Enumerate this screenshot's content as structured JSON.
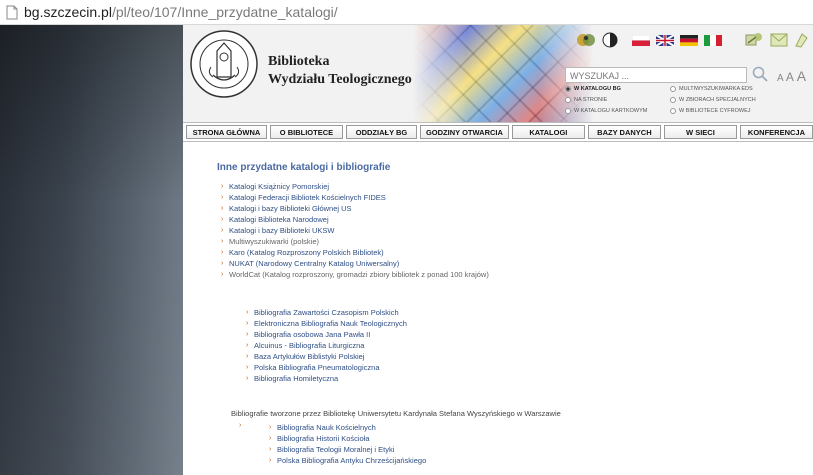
{
  "browser": {
    "url_host": "bg.szczecin.pl",
    "url_path": "/pl/teo/107/Inne_przydatne_katalogi/"
  },
  "header": {
    "title_line1": "Biblioteka",
    "title_line2": "Wydziału Teologicznego",
    "search_placeholder": "WYSZUKAJ ...",
    "font_size_labels": [
      "A",
      "A",
      "A"
    ],
    "radio_options": [
      {
        "label": "W KATALOGU BG",
        "selected": true
      },
      {
        "label": "MULTIWYSZUKIWARKA EDS",
        "selected": false
      },
      {
        "label": "NA STRONIE",
        "selected": false
      },
      {
        "label": "W ZBIORACH SPECJALNYCH",
        "selected": false
      },
      {
        "label": "W KATALOGU KARTKOWYM",
        "selected": false
      },
      {
        "label": "W BIBLIOTECE CYFROWEJ",
        "selected": false
      }
    ]
  },
  "nav": {
    "items": [
      "STRONA GŁÓWNA",
      "O BIBLIOTECE",
      "ODDZIAŁY BG",
      "GODZINY OTWARCIA",
      "KATALOGI",
      "BAZY DANYCH",
      "W SIECI",
      "KONFERENCJA"
    ]
  },
  "content": {
    "heading": "Inne przydatne katalogi i bibliografie",
    "catalogs": [
      "Katalogi Książnicy Pomorskiej",
      "Katalogi Federacji Bibliotek Kościelnych FIDES",
      "Katalogi i bazy Biblioteki Głównej US",
      "Katalogi Biblioteka Narodowej",
      "Katalogi i bazy Biblioteki UKSW",
      "Multiwyszukiwarki (polskie)",
      "Karo (Katalog Rozproszony Polskich Bibliotek)",
      "NUKAT (Narodowy Centralny Katalog Uniwersalny)",
      "WorldCat (Katalog rozproszony, gromadzi zbiory bibliotek z ponad 100 krajów)"
    ],
    "bibliographies": [
      "Bibliografia Zawartości Czasopism Polskich",
      "Elektroniczna Bibliografia Nauk Teologicznych",
      "Bibliografia osobowa Jana Pawła II",
      "Alcuinus - Bibliografia Liturgiczna",
      "Baza Artykułów Biblistyki Polskiej",
      "Polska Bibliografia Pneumatologiczna",
      "Bibliografia Homiletyczna"
    ],
    "uksw_note": "Bibliografie tworzone przez Bibliotekę Uniwersytetu Kardynała Stefana Wyszyńskiego w Warszawie",
    "uksw_list": [
      "Bibliografia Nauk Kościelnych",
      "Bibliografia Historii Kościoła",
      "Bibliografia Teologii Moralnej i Etyki",
      "Polska Bibliografia Antyku Chrześcijańskiego"
    ]
  },
  "colors": {
    "link": "#2f4f86",
    "heading": "#4b6aa3",
    "bullet": "#c25a1b"
  }
}
